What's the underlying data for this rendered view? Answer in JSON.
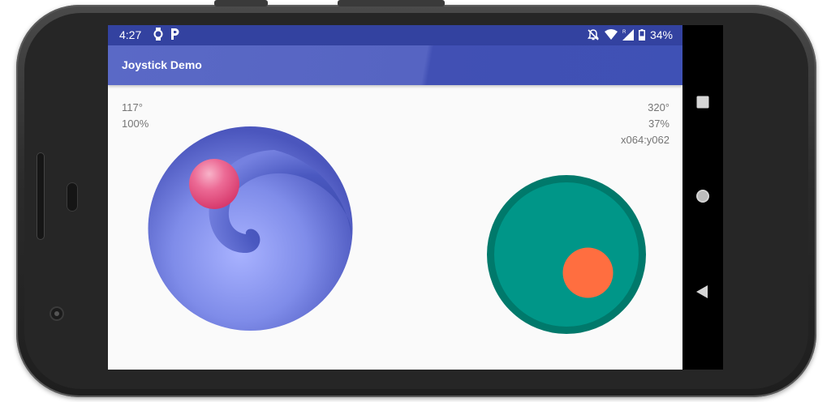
{
  "status_bar": {
    "time": "4:27",
    "left_icons": [
      "watch-icon",
      "parking-icon"
    ],
    "right_icons": [
      "notifications-off-icon",
      "wifi-icon",
      "signal-icon",
      "battery-icon"
    ],
    "battery": "34%",
    "color": "#3342a0"
  },
  "app_bar": {
    "title": "Joystick Demo",
    "color": "#3f51b5"
  },
  "left_joystick": {
    "angle": "117°",
    "strength": "100%",
    "button_color": "#e8457a",
    "base_color": "#7b87e6"
  },
  "right_joystick": {
    "angle": "320°",
    "strength": "37%",
    "coordinates": "x064:y062",
    "base_color": "#009688",
    "border_color": "#00796b",
    "button_color": "#ff6e40"
  },
  "nav_bar": {
    "buttons": [
      "recents-button",
      "home-button",
      "back-button"
    ]
  }
}
